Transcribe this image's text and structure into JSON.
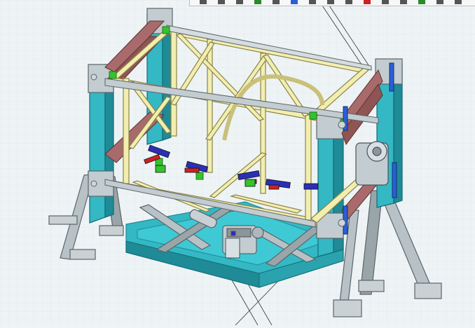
{
  "viewport": {
    "background": "#eef3f5",
    "grid_color": "#dde6ea"
  },
  "toolbar": {
    "icons": [
      "toolbar-icon-1",
      "toolbar-icon-2",
      "toolbar-icon-3",
      "toolbar-icon-4",
      "toolbar-icon-5",
      "toolbar-icon-6",
      "toolbar-icon-7",
      "toolbar-icon-8",
      "toolbar-icon-9",
      "toolbar-icon-10",
      "toolbar-icon-11",
      "toolbar-icon-12",
      "toolbar-icon-13",
      "toolbar-icon-14",
      "toolbar-icon-15"
    ]
  },
  "model": {
    "colors": {
      "frame_yellow": "#f2eeb0",
      "frame_yellow_dark": "#c9c07a",
      "teal": "#33b8c4",
      "teal_dark": "#1e8b97",
      "maroon": "#a86a6a",
      "maroon_dark": "#7a4646",
      "steel": "#b8c2c6",
      "steel_dark": "#7d878b",
      "green_block": "#34c22e",
      "blue_clamp": "#2a2fb8",
      "red_clamp": "#cc2222"
    }
  }
}
